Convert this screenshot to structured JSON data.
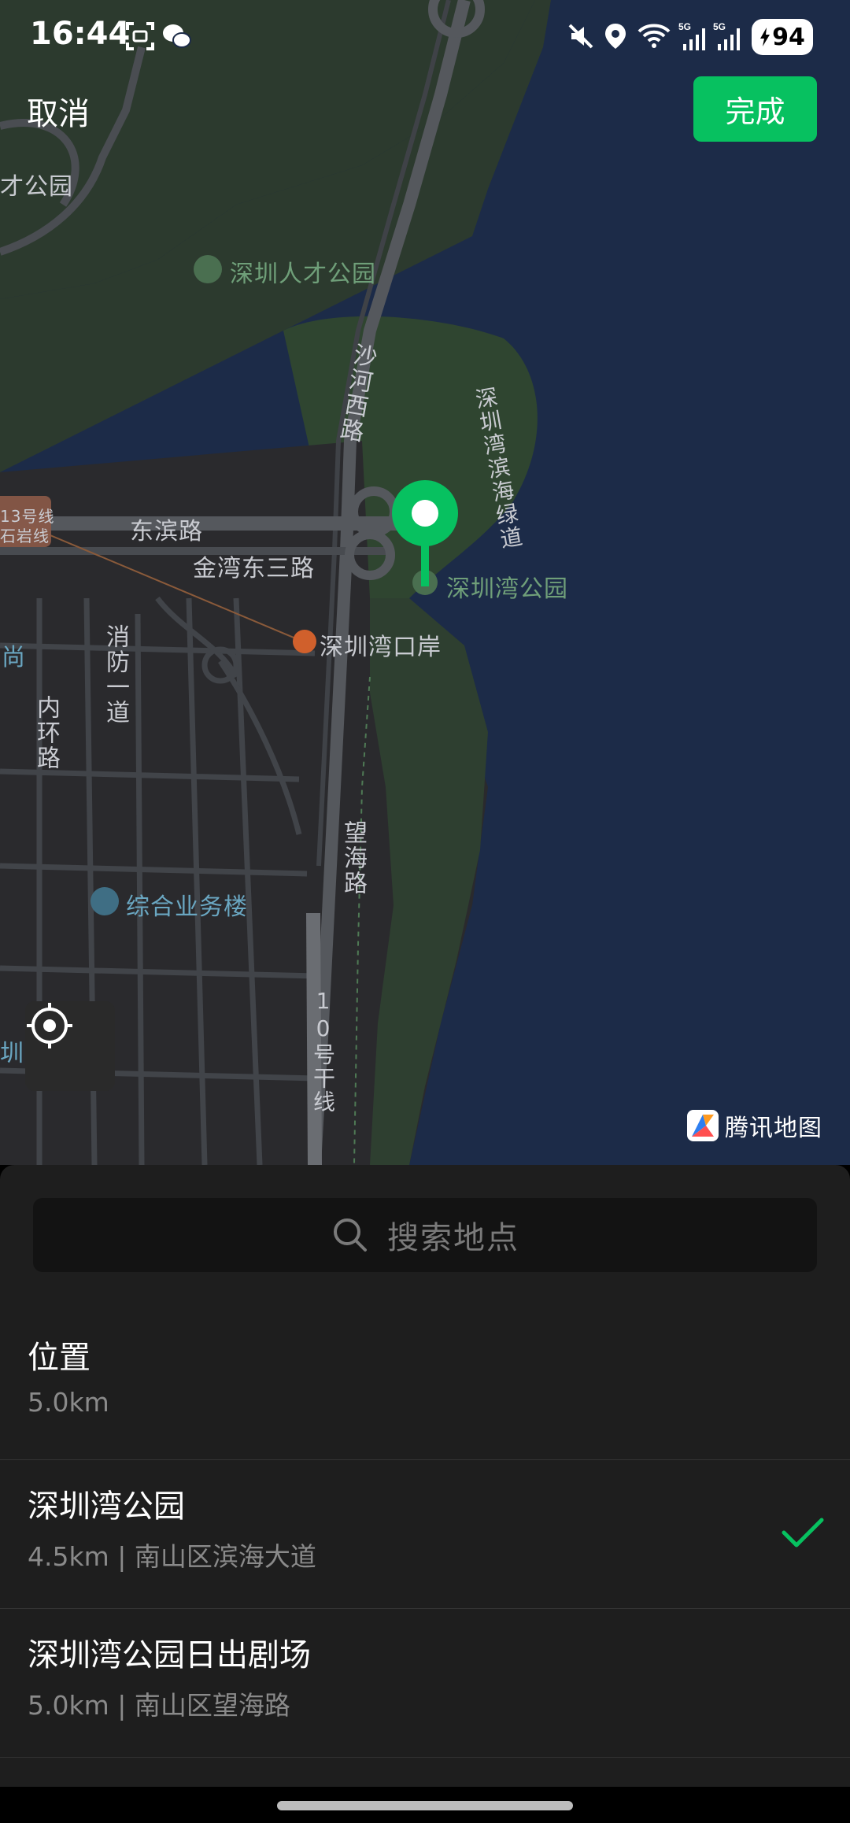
{
  "status_bar": {
    "time": "16:44",
    "battery": "94",
    "icons": [
      "screenshot-icon",
      "wechat-icon",
      "mute-icon",
      "location-icon",
      "wifi-icon",
      "signal-5g-icon",
      "signal-5g-icon",
      "battery-charging-icon"
    ],
    "signal_label_1": "5G",
    "signal_label_2": "5G"
  },
  "top_bar": {
    "cancel_label": "取消",
    "done_label": "完成",
    "accent_color": "#07c160"
  },
  "map": {
    "labels": {
      "park_cut": "才公园",
      "talent_park": "深圳人才公园",
      "shahe_road": "沙河西路",
      "greenway": "深圳湾滨海绿道",
      "dongbin_road": "东滨路",
      "jinwan_road": "金湾东三路",
      "bay_park": "深圳湾公园",
      "port": "深圳湾口岸",
      "xiaofang_road": "消防一道",
      "neihuan_road": "内环路",
      "wanghai_road": "望海路",
      "office_building": "综合业务楼",
      "ganxian": "10号干线",
      "metro_line_1": "13号线",
      "metro_line_2": "石岩线",
      "left_edge_1": "尚",
      "left_edge_2": "圳"
    },
    "logo_text": "腾讯地图"
  },
  "search": {
    "placeholder": "搜索地点"
  },
  "results": [
    {
      "title": "位置",
      "subtitle": "5.0km",
      "selected": false
    },
    {
      "title": "深圳湾公园",
      "subtitle": "4.5km | 南山区滨海大道",
      "selected": true
    },
    {
      "title": "深圳湾公园日出剧场",
      "subtitle": "5.0km | 南山区望海路",
      "selected": false
    }
  ]
}
